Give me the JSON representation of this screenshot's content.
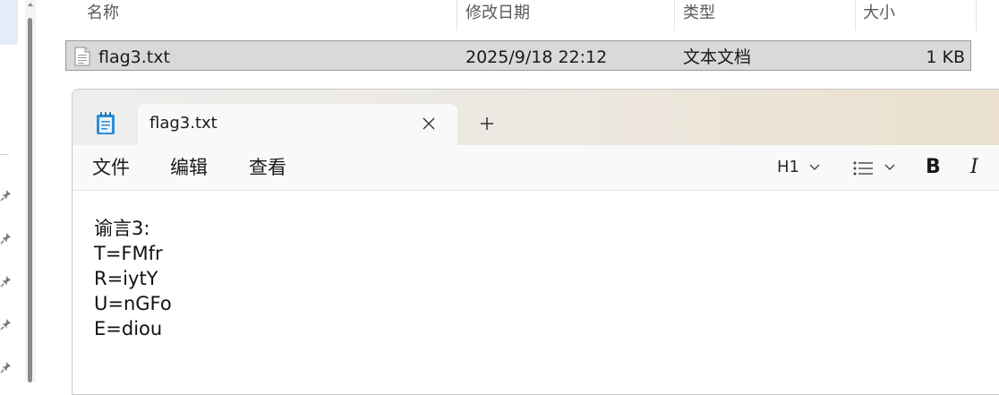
{
  "explorer": {
    "columns": {
      "name": "名称",
      "modified": "修改日期",
      "type": "类型",
      "size": "大小"
    },
    "file": {
      "name": "flag3.txt",
      "modified": "2025/9/18 22:12",
      "type": "文本文档",
      "size": "1 KB"
    },
    "icons": {
      "pin": "pin-icon",
      "file": "text-file-icon",
      "scroll_up": "chevron-up-icon"
    }
  },
  "notepad": {
    "tab_title": "flag3.txt",
    "new_tab_label": "+",
    "menu": {
      "file": "文件",
      "edit": "编辑",
      "view": "查看"
    },
    "toolbar": {
      "heading": "H1",
      "bold": "B",
      "italic": "I"
    },
    "content": {
      "lines": [
        "谕言3:",
        "T=FMfr",
        "R=iytY",
        "U=nGFo",
        "E=diou"
      ]
    },
    "icons": {
      "app": "notepad-icon",
      "close": "close-icon",
      "chevron": "chevron-down-icon",
      "list": "list-icon"
    }
  }
}
